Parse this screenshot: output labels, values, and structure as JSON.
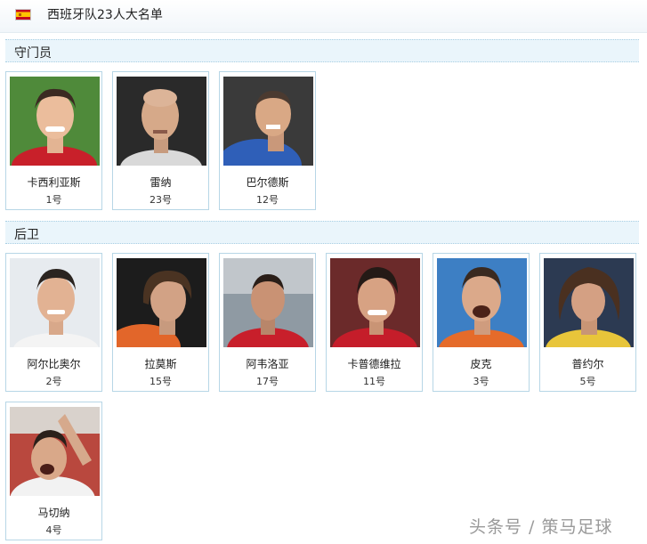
{
  "header": {
    "title": "西班牙队23人大名单",
    "flag_icon": "spain-flag-icon"
  },
  "sections": {
    "goalkeepers": {
      "label": "守门员",
      "players": [
        {
          "name": "卡西利亚斯",
          "number": "1号"
        },
        {
          "name": "雷纳",
          "number": "23号"
        },
        {
          "name": "巴尔德斯",
          "number": "12号"
        }
      ]
    },
    "defenders": {
      "label": "后卫",
      "players": [
        {
          "name": "阿尔比奥尔",
          "number": "2号"
        },
        {
          "name": "拉莫斯",
          "number": "15号"
        },
        {
          "name": "阿韦洛亚",
          "number": "17号"
        },
        {
          "name": "卡普德维拉",
          "number": "11号"
        },
        {
          "name": "皮克",
          "number": "3号"
        },
        {
          "name": "普约尔",
          "number": "5号"
        },
        {
          "name": "马切纳",
          "number": "4号"
        }
      ]
    }
  },
  "watermark": "头条号 / 策马足球",
  "colors": {
    "section_bg": "#eaf5fb",
    "card_border": "#b7d6e6",
    "spain_red": "#c60b1e",
    "spain_yellow": "#ffc400"
  }
}
